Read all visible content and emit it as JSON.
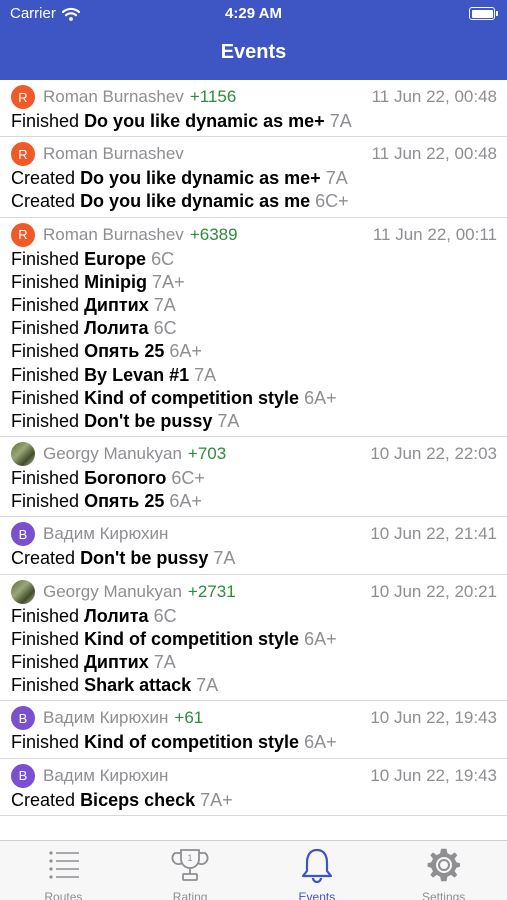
{
  "status_bar": {
    "carrier": "Carrier",
    "time": "4:29 AM"
  },
  "nav": {
    "title": "Events"
  },
  "events": [
    {
      "avatar": "R",
      "avatar_style": "orange",
      "user": "Roman Burnashev",
      "score": "+1156",
      "time": "11 Jun 22, 00:48",
      "lines": [
        {
          "action": "Finished",
          "route": "Do you like dynamic as me+",
          "grade": "7A"
        }
      ]
    },
    {
      "avatar": "R",
      "avatar_style": "orange",
      "user": "Roman Burnashev",
      "score": "",
      "time": "11 Jun 22, 00:48",
      "lines": [
        {
          "action": "Created",
          "route": "Do you like dynamic as me+",
          "grade": "7A"
        },
        {
          "action": "Created",
          "route": "Do you like dynamic as me",
          "grade": "6C+"
        }
      ]
    },
    {
      "avatar": "R",
      "avatar_style": "orange",
      "user": "Roman Burnashev",
      "score": "+6389",
      "time": "11 Jun 22, 00:11",
      "lines": [
        {
          "action": "Finished",
          "route": "Europe",
          "grade": "6C"
        },
        {
          "action": "Finished",
          "route": "Minipig ",
          "grade": "7A+"
        },
        {
          "action": "Finished",
          "route": "Диптих",
          "grade": "7A"
        },
        {
          "action": "Finished",
          "route": "Лолита",
          "grade": "6C"
        },
        {
          "action": "Finished",
          "route": "Опять 25 ",
          "grade": "6A+"
        },
        {
          "action": "Finished",
          "route": "By Levan #1",
          "grade": "7A"
        },
        {
          "action": "Finished",
          "route": "Kind of competition style",
          "grade": "6A+"
        },
        {
          "action": "Finished",
          "route": "Don't be pussy",
          "grade": "7A"
        }
      ]
    },
    {
      "avatar": "",
      "avatar_style": "photo",
      "user": "Georgy Manukyan",
      "score": "+703",
      "time": "10 Jun 22, 22:03",
      "lines": [
        {
          "action": "Finished",
          "route": "Богопого",
          "grade": "6C+"
        },
        {
          "action": "Finished",
          "route": "Опять 25 ",
          "grade": "6A+"
        }
      ]
    },
    {
      "avatar": "В",
      "avatar_style": "purple",
      "user": "Вадим Кирюхин",
      "score": "",
      "time": "10 Jun 22, 21:41",
      "lines": [
        {
          "action": "Created",
          "route": "Don't be pussy",
          "grade": "7A"
        }
      ]
    },
    {
      "avatar": "",
      "avatar_style": "photo",
      "user": "Georgy Manukyan",
      "score": "+2731",
      "time": "10 Jun 22, 20:21",
      "lines": [
        {
          "action": "Finished",
          "route": "Лолита",
          "grade": "6C"
        },
        {
          "action": "Finished",
          "route": "Kind of competition style",
          "grade": "6A+"
        },
        {
          "action": "Finished",
          "route": "Диптих",
          "grade": "7A"
        },
        {
          "action": "Finished",
          "route": "Shark attack",
          "grade": "7A"
        }
      ]
    },
    {
      "avatar": "В",
      "avatar_style": "purple",
      "user": "Вадим Кирюхин",
      "score": "+61",
      "time": "10 Jun 22, 19:43",
      "lines": [
        {
          "action": "Finished",
          "route": "Kind of competition style",
          "grade": "6A+"
        }
      ]
    },
    {
      "avatar": "В",
      "avatar_style": "purple",
      "user": "Вадим Кирюхин",
      "score": "",
      "time": "10 Jun 22, 19:43",
      "lines": [
        {
          "action": "Created",
          "route": "Biceps check",
          "grade": "7A+"
        }
      ]
    }
  ],
  "tabs": [
    {
      "label": "Routes",
      "icon": "list-icon",
      "active": false
    },
    {
      "label": "Rating",
      "icon": "trophy-icon",
      "active": false,
      "badge": "1"
    },
    {
      "label": "Events",
      "icon": "bell-icon",
      "active": true
    },
    {
      "label": "Settings",
      "icon": "gear-icon",
      "active": false
    }
  ],
  "colors": {
    "header": "#3e55c4",
    "score": "#2e8b3d",
    "muted": "#8e8e93",
    "accent": "#3e55c4"
  }
}
